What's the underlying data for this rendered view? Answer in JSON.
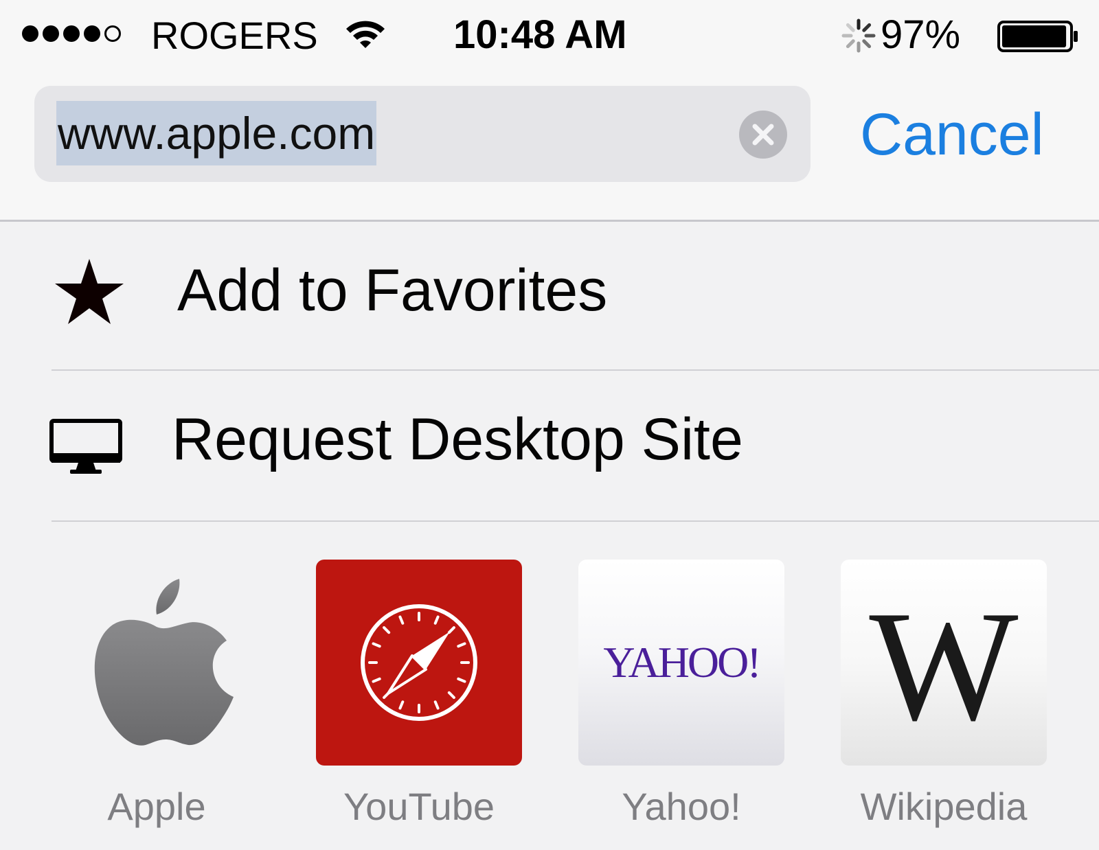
{
  "status_bar": {
    "signal_strength": {
      "filled": 4,
      "total": 5
    },
    "carrier": "ROGERS",
    "wifi_icon": "wifi-icon",
    "time": "10:48 AM",
    "activity_icon": "network-activity-spinner-icon",
    "battery_percent": "97%",
    "battery_level": 0.97
  },
  "address_bar": {
    "url": "www.apple.com",
    "url_selected": true,
    "clear_icon": "clear-icon",
    "cancel_label": "Cancel"
  },
  "menu": {
    "items": [
      {
        "label": "Add to Favorites",
        "icon": "star-icon"
      },
      {
        "label": "Request Desktop Site",
        "icon": "desktop-monitor-icon"
      }
    ]
  },
  "favorites": {
    "items": [
      {
        "label": "Apple",
        "icon": "apple-logo-icon"
      },
      {
        "label": "YouTube",
        "icon": "safari-compass-icon"
      },
      {
        "label": "Yahoo!",
        "logo_text": "YAHOO!"
      },
      {
        "label": "Wikipedia",
        "logo_text": "W"
      }
    ]
  },
  "colors": {
    "accent": "#1b7fe0",
    "selection": "#c4cfdf",
    "youtube_tile": "#bd1610",
    "yahoo_purple": "#4a1f9a",
    "favorite_label": "#7e7e82"
  }
}
